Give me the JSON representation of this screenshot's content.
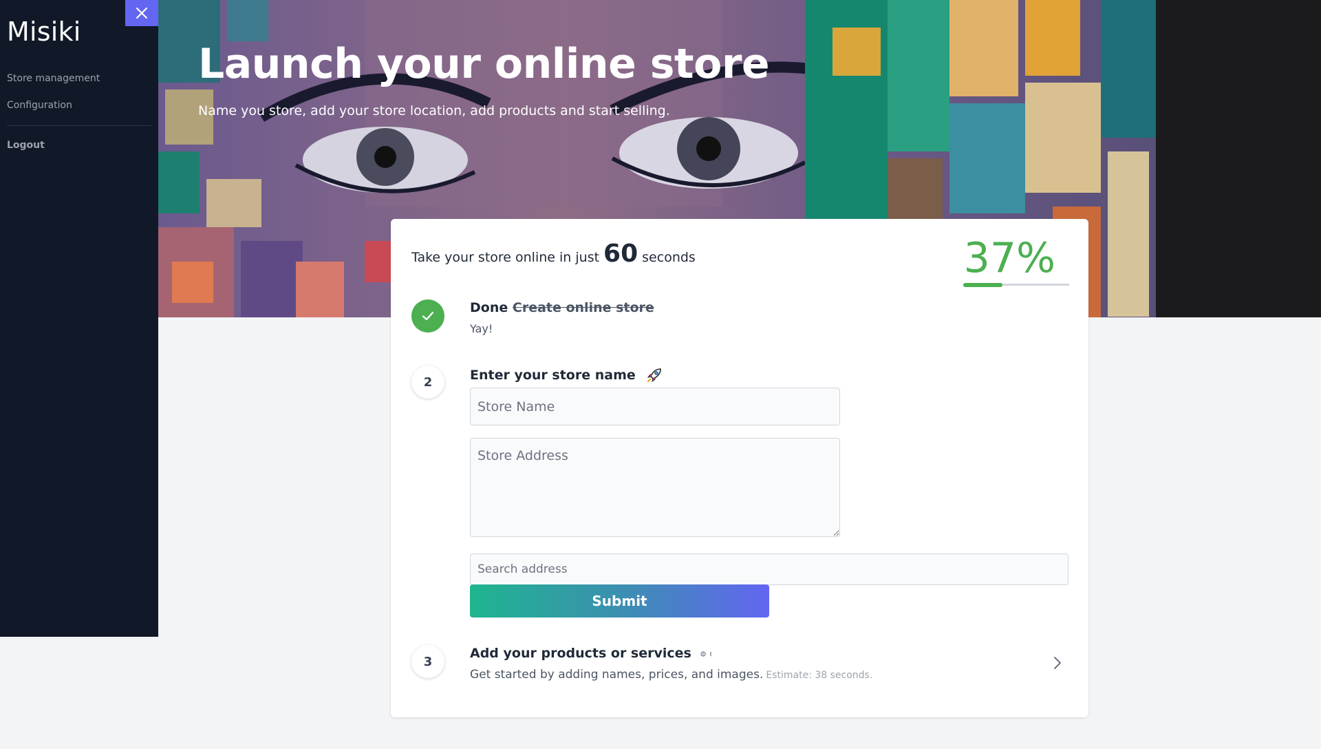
{
  "sidebar": {
    "brand": "Misiki",
    "items": [
      {
        "label": "Store management"
      },
      {
        "label": "Configuration"
      }
    ],
    "logout_label": "Logout",
    "close_icon": "close-icon"
  },
  "hero": {
    "title": "Launch your online store",
    "subtitle": "Name you store, add your store location, add products and start selling."
  },
  "card": {
    "heading_prefix": "Take your store online in just",
    "heading_number": "60",
    "heading_suffix": "seconds",
    "progress_label": "37%",
    "progress_value": 0.37,
    "accent_color": "#4caf50"
  },
  "steps": {
    "step1": {
      "status": "Done",
      "title": "Create online store",
      "note": "Yay!",
      "icon": "check-icon"
    },
    "step2": {
      "number": "2",
      "title": "Enter your store name",
      "icon": "rocket-icon",
      "store_name_placeholder": "Store Name",
      "store_name_value": "",
      "store_address_placeholder": "Store Address",
      "store_address_value": "",
      "search_placeholder": "Search address",
      "search_value": "",
      "submit_label": "Submit"
    },
    "step3": {
      "number": "3",
      "title": "Add your products or services",
      "icon": "broken-image-icon",
      "description": "Get started by adding names, prices, and images.",
      "estimate": "Estimate: 38 seconds.",
      "chevron_icon": "chevron-right-icon"
    }
  }
}
